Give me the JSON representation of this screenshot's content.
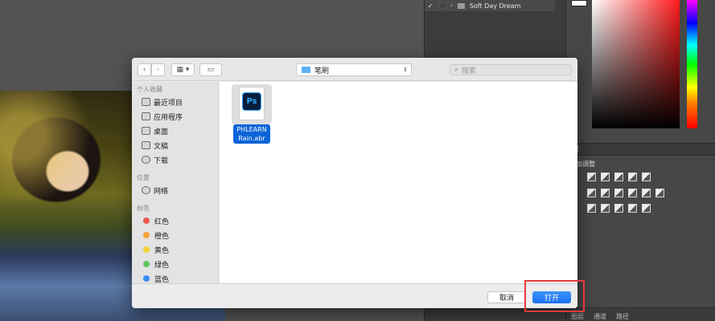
{
  "photoshop": {
    "layers": {
      "row": {
        "check": "✓",
        "name": "Soft Day Dream"
      }
    },
    "adjustments": {
      "header_title": "整",
      "subtitle": "加调整"
    },
    "bottom_tabs": [
      "图层",
      "通道",
      "路径"
    ]
  },
  "dialog": {
    "toolbar": {
      "back_icon": "chevron-left-icon",
      "forward_icon": "chevron-right-icon",
      "view_icon": "grid-view-icon",
      "new_folder_icon": "new-folder-icon",
      "path_label": "笔刷",
      "search_placeholder": "搜索"
    },
    "sidebar": {
      "favorites_heading": "个人收藏",
      "favorites": [
        {
          "label": "最近项目",
          "icon": "recents-icon"
        },
        {
          "label": "应用程序",
          "icon": "applications-icon"
        },
        {
          "label": "桌面",
          "icon": "desktop-icon"
        },
        {
          "label": "文稿",
          "icon": "documents-icon"
        },
        {
          "label": "下载",
          "icon": "downloads-icon"
        }
      ],
      "locations_heading": "位置",
      "locations": [
        {
          "label": "网络",
          "icon": "network-icon"
        }
      ],
      "tags_heading": "标签",
      "tags": [
        {
          "label": "红色",
          "color": "#ee5a4f"
        },
        {
          "label": "橙色",
          "color": "#f5a23b"
        },
        {
          "label": "黄色",
          "color": "#f5cf35"
        },
        {
          "label": "绿色",
          "color": "#5ac55b"
        },
        {
          "label": "蓝色",
          "color": "#3c8ef0"
        }
      ]
    },
    "files": [
      {
        "name_line1": "PHLEARN",
        "name_line2": "Rain.abr",
        "badge": "Ps",
        "selected": true
      }
    ],
    "footer": {
      "cancel_label": "取消",
      "open_label": "打开"
    }
  },
  "colors": {
    "accent_blue": "#1a6ff0",
    "highlight_red": "#e53b3b",
    "ps_badge_bg": "#061e3c",
    "ps_badge_fg": "#31a8ff"
  }
}
